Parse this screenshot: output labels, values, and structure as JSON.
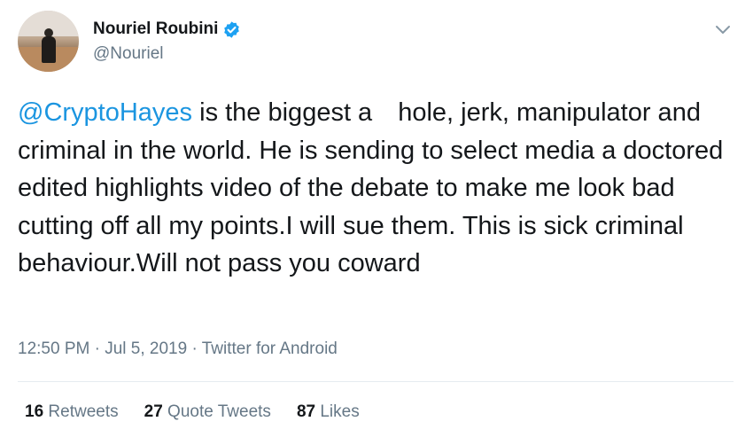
{
  "author": {
    "display_name": "Nouriel Roubini",
    "handle": "@Nouriel",
    "verified": true,
    "avatar_icon": "profile-photo"
  },
  "tweet": {
    "mention": "@CryptoHayes",
    "text_after_mention": " is the biggest a  hole, jerk, manipulator and criminal in the world. He is sending to select media a doctored edited highlights video of the debate to make me look bad cutting off all my points.I will sue them. This is sick criminal behaviour.Will not pass you coward"
  },
  "meta": {
    "time": "12:50 PM",
    "separator": " · ",
    "date": "Jul 5, 2019",
    "source": "Twitter for Android"
  },
  "stats": {
    "retweets_count": "16",
    "retweets_label": "Retweets",
    "quotes_count": "27",
    "quotes_label": "Quote Tweets",
    "likes_count": "87",
    "likes_label": "Likes"
  },
  "colors": {
    "mention": "#1b95e0",
    "muted": "#657786",
    "verified": "#1da1f2"
  }
}
